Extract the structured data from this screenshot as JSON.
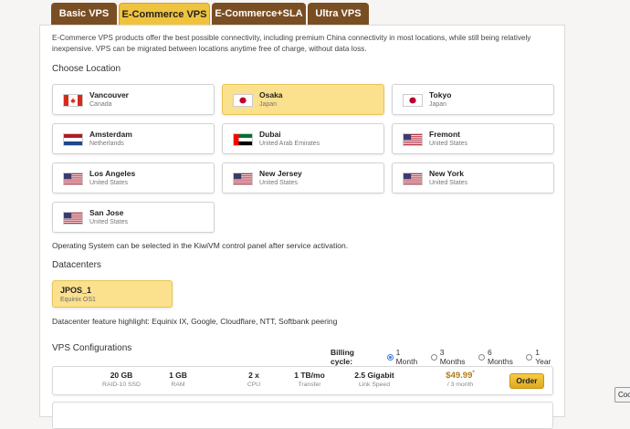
{
  "tabs": [
    {
      "label": "Basic VPS",
      "active": false
    },
    {
      "label": "E-Commerce VPS",
      "active": true
    },
    {
      "label": "E-Commerce+SLA",
      "active": false
    },
    {
      "label": "Ultra VPS",
      "active": false
    }
  ],
  "intro": "E-Commerce VPS products offer the best possible connectivity, including premium China connectivity in most locations, while still being relatively inexpensive. VPS can be migrated between locations anytime free of charge, without data loss.",
  "location": {
    "title": "Choose Location",
    "selected": "Osaka",
    "items": [
      {
        "city": "Vancouver",
        "country": "Canada",
        "flag": "canada-flag-icon"
      },
      {
        "city": "Osaka",
        "country": "Japan",
        "flag": "japan-flag-icon"
      },
      {
        "city": "Tokyo",
        "country": "Japan",
        "flag": "japan-flag-icon"
      },
      {
        "city": "Amsterdam",
        "country": "Netherlands",
        "flag": "netherlands-flag-icon"
      },
      {
        "city": "Dubai",
        "country": "United Arab Emirates",
        "flag": "uae-flag-icon"
      },
      {
        "city": "Fremont",
        "country": "United States",
        "flag": "us-flag-icon"
      },
      {
        "city": "Los Angeles",
        "country": "United States",
        "flag": "us-flag-icon"
      },
      {
        "city": "New Jersey",
        "country": "United States",
        "flag": "us-flag-icon"
      },
      {
        "city": "New York",
        "country": "United States",
        "flag": "us-flag-icon"
      },
      {
        "city": "San Jose",
        "country": "United States",
        "flag": "us-flag-icon"
      }
    ]
  },
  "os_note": "Operating System can be selected in the KiwiVM control panel after service activation.",
  "datacenters": {
    "title": "Datacenters",
    "selected": {
      "name": "JPOS_1",
      "desc": "Equinix OS1"
    },
    "highlight": "Datacenter feature highlight: Equinix IX, Google, Cloudflare, NTT, Softbank peering"
  },
  "configs": {
    "title": "VPS Configurations",
    "billing": {
      "label": "Billing cycle:",
      "options": [
        "1 Month",
        "3 Months",
        "6 Months",
        "1 Year"
      ],
      "selected": "1 Month"
    },
    "plan": {
      "storage": "20 GB",
      "storage_sub": "RAID-10 SSD",
      "ram": "1 GB",
      "ram_sub": "RAM",
      "cpu": "2 x",
      "cpu_sub": "CPU",
      "transfer": "1 TB/mo",
      "transfer_sub": "Transfer",
      "link": "2.5 Gigabit",
      "link_sub": "Link Speed",
      "price": "$49.99",
      "price_mark": "*",
      "price_sub": "/ 3 month",
      "order": "Order"
    }
  },
  "cookie_btn": "Coo",
  "colors": {
    "accent": "#f0c33e",
    "tab_dark": "#7a4e23",
    "selected_bg": "#fbe08d",
    "price": "#b07a1a"
  }
}
